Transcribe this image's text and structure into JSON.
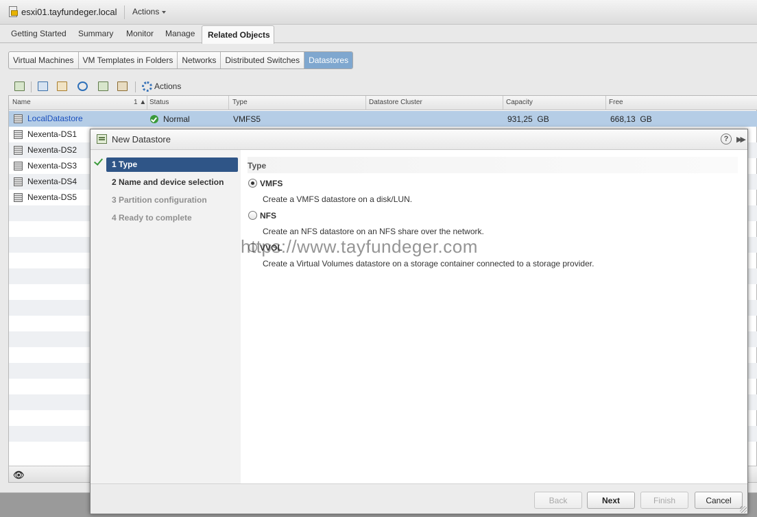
{
  "app": {
    "host_title": "esxi01.tayfundeger.local",
    "actions_label": "Actions",
    "tabs": [
      {
        "label": "Getting Started"
      },
      {
        "label": "Summary"
      },
      {
        "label": "Monitor"
      },
      {
        "label": "Manage"
      },
      {
        "label": "Related Objects"
      }
    ],
    "active_tab": "Related Objects",
    "subtabs": [
      {
        "label": "Virtual Machines"
      },
      {
        "label": "VM Templates in Folders"
      },
      {
        "label": "Networks"
      },
      {
        "label": "Distributed Switches"
      },
      {
        "label": "Datastores"
      }
    ],
    "active_subtab": "Datastores",
    "toolbar": {
      "actions_label": "Actions",
      "icons": [
        "new-datastore-icon",
        "register-vm-icon",
        "browse-files-icon",
        "refresh-icon",
        "increase-capacity-icon",
        "datastore-settings-icon",
        "gear-icon"
      ]
    }
  },
  "grid": {
    "columns": {
      "name": "Name",
      "sort_indicator": "1 ▲",
      "status": "Status",
      "type": "Type",
      "cluster": "Datastore Cluster",
      "capacity": "Capacity",
      "free": "Free"
    },
    "rows": [
      {
        "name": "LocalDatastore",
        "status": "Normal",
        "type": "VMFS5",
        "cluster": "",
        "capacity": "931,25  GB",
        "free": "668,13  GB"
      },
      {
        "name": "Nexenta-DS1"
      },
      {
        "name": "Nexenta-DS2"
      },
      {
        "name": "Nexenta-DS3"
      },
      {
        "name": "Nexenta-DS4"
      },
      {
        "name": "Nexenta-DS5"
      }
    ]
  },
  "dialog": {
    "title": "New Datastore",
    "steps": [
      {
        "label": "1  Type"
      },
      {
        "label": "2  Name and device selection"
      },
      {
        "label": "3  Partition configuration"
      },
      {
        "label": "4  Ready to complete"
      }
    ],
    "section_title": "Type",
    "options": [
      {
        "label": "VMFS",
        "description": "Create a VMFS datastore on a disk/LUN.",
        "selected": true
      },
      {
        "label": "NFS",
        "description": "Create an NFS datastore on an NFS share over the network.",
        "selected": false
      },
      {
        "label": "VVOL",
        "description": "Create a Virtual Volumes datastore on a storage container connected to a storage provider.",
        "selected": false
      }
    ],
    "watermark": "https://www.tayfundeger.com",
    "buttons": {
      "back": "Back",
      "next": "Next",
      "finish": "Finish",
      "cancel": "Cancel"
    },
    "help_icon": "?"
  }
}
